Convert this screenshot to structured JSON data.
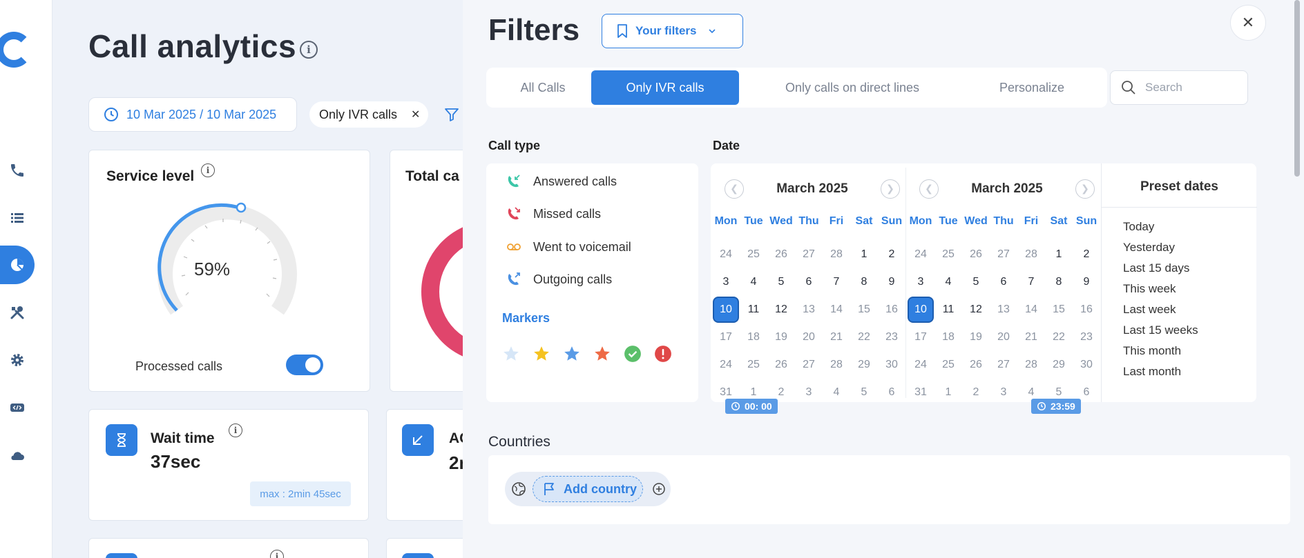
{
  "app": {
    "page_title": "Call analytics",
    "date_range": "10 Mar 2025 / 10 Mar 2025",
    "active_chip": "Only IVR calls",
    "accent_color": "#2f7fe0"
  },
  "nav": {
    "items": [
      {
        "icon": "phone-icon"
      },
      {
        "icon": "list-icon"
      },
      {
        "icon": "pie-chart-icon",
        "active": true
      },
      {
        "icon": "tools-icon"
      },
      {
        "icon": "gear-icon"
      },
      {
        "icon": "code-icon"
      },
      {
        "icon": "cloud-icon"
      }
    ]
  },
  "cards": {
    "service_level": {
      "title": "Service level",
      "value": "59%",
      "gauge_fraction": 0.59,
      "toggle_label": "Processed calls",
      "toggle_on": true
    },
    "total_calls": {
      "title": "Total ca"
    },
    "wait_time": {
      "title": "Wait time",
      "value": "37sec",
      "max_label": "max : 2min 45sec"
    },
    "answered": {
      "title": "AC",
      "value": "2n"
    }
  },
  "filters": {
    "title": "Filters",
    "your_filters_label": "Your filters",
    "tabs": [
      {
        "label": "All Calls",
        "active": false
      },
      {
        "label": "Only IVR calls",
        "active": true
      },
      {
        "label": "Only calls on direct lines",
        "active": false
      },
      {
        "label": "Personalize",
        "active": false
      }
    ],
    "search_placeholder": "Search",
    "call_type_label": "Call type",
    "call_types": [
      {
        "label": "Answered calls",
        "icon": "answered-call-icon",
        "color": "#3cc6a8"
      },
      {
        "label": "Missed calls",
        "icon": "missed-call-icon",
        "color": "#e0455a"
      },
      {
        "label": "Went to voicemail",
        "icon": "voicemail-icon",
        "color": "#f0a030"
      },
      {
        "label": "Outgoing calls",
        "icon": "outgoing-call-icon",
        "color": "#4a90e2"
      }
    ],
    "markers_label": "Markers",
    "markers": [
      {
        "icon": "star-outline-icon",
        "color": "#d6e6f7"
      },
      {
        "icon": "star-yellow-icon",
        "color": "#f5c220"
      },
      {
        "icon": "star-blue-icon",
        "color": "#5a9be6"
      },
      {
        "icon": "star-orange-icon",
        "color": "#ee6a45"
      },
      {
        "icon": "check-icon",
        "color": "#5bbf6a"
      },
      {
        "icon": "alert-icon",
        "color": "#e04848"
      }
    ],
    "date_label": "Date",
    "calendars": [
      {
        "title": "March 2025",
        "time": "00: 00"
      },
      {
        "title": "March 2025",
        "time": "23:59"
      }
    ],
    "weekdays": [
      "Mon",
      "Tue",
      "Wed",
      "Thu",
      "Fri",
      "Sat",
      "Sun"
    ],
    "weeks": [
      [
        {
          "d": "24",
          "o": 1
        },
        {
          "d": "25",
          "o": 1
        },
        {
          "d": "26",
          "o": 1
        },
        {
          "d": "27",
          "o": 1
        },
        {
          "d": "28",
          "o": 1
        },
        {
          "d": "1",
          "o": 0
        },
        {
          "d": "2",
          "o": 0
        }
      ],
      [
        {
          "d": "3",
          "o": 0
        },
        {
          "d": "4",
          "o": 0
        },
        {
          "d": "5",
          "o": 0
        },
        {
          "d": "6",
          "o": 0
        },
        {
          "d": "7",
          "o": 0
        },
        {
          "d": "8",
          "o": 0
        },
        {
          "d": "9",
          "o": 0
        }
      ],
      [
        {
          "d": "10",
          "o": 0,
          "s": 1
        },
        {
          "d": "11",
          "o": 0
        },
        {
          "d": "12",
          "o": 0
        },
        {
          "d": "13",
          "o": 1
        },
        {
          "d": "14",
          "o": 1
        },
        {
          "d": "15",
          "o": 1
        },
        {
          "d": "16",
          "o": 1
        }
      ],
      [
        {
          "d": "17",
          "o": 1
        },
        {
          "d": "18",
          "o": 1
        },
        {
          "d": "19",
          "o": 1
        },
        {
          "d": "20",
          "o": 1
        },
        {
          "d": "21",
          "o": 1
        },
        {
          "d": "22",
          "o": 1
        },
        {
          "d": "23",
          "o": 1
        }
      ],
      [
        {
          "d": "24",
          "o": 1
        },
        {
          "d": "25",
          "o": 1
        },
        {
          "d": "26",
          "o": 1
        },
        {
          "d": "27",
          "o": 1
        },
        {
          "d": "28",
          "o": 1
        },
        {
          "d": "29",
          "o": 1
        },
        {
          "d": "30",
          "o": 1
        }
      ],
      [
        {
          "d": "31",
          "o": 1
        },
        {
          "d": "1",
          "o": 1
        },
        {
          "d": "2",
          "o": 1
        },
        {
          "d": "3",
          "o": 1
        },
        {
          "d": "4",
          "o": 1
        },
        {
          "d": "5",
          "o": 1
        },
        {
          "d": "6",
          "o": 1
        }
      ]
    ],
    "preset_title": "Preset dates",
    "presets": [
      "Today",
      "Yesterday",
      "Last 15 days",
      "This week",
      "Last week",
      "Last 15 weeks",
      "This month",
      "Last month"
    ],
    "countries_label": "Countries",
    "add_country_label": "Add country"
  }
}
